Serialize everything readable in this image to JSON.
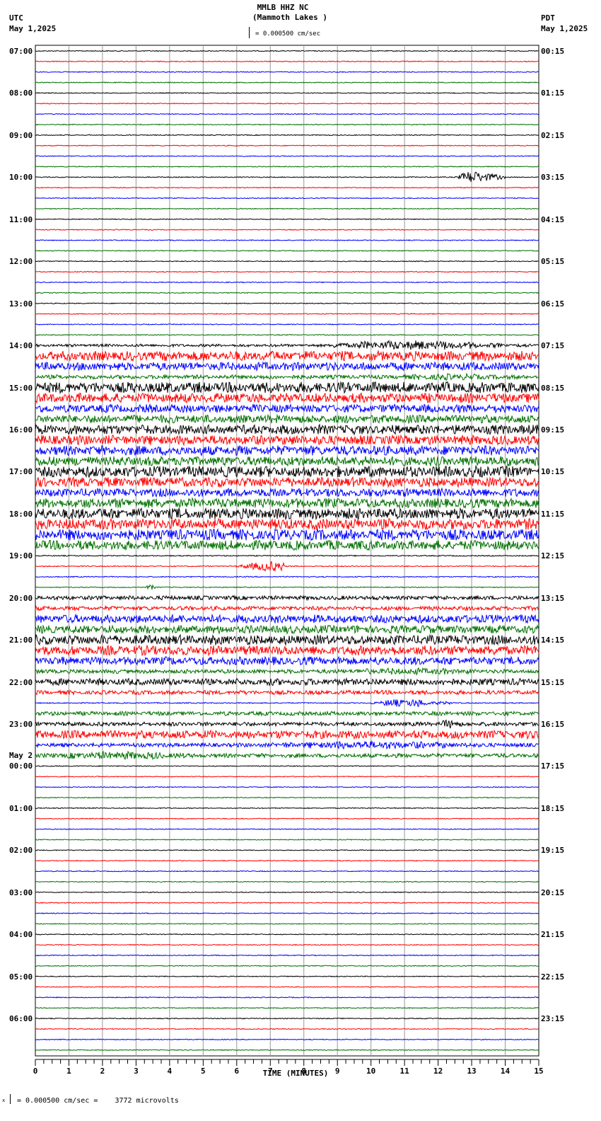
{
  "header": {
    "station": "MMLB HHZ NC",
    "location": "(Mammoth Lakes )",
    "left_tz": "UTC",
    "left_date": "May 1,2025",
    "right_tz": "PDT",
    "right_date": "May 1,2025",
    "scale": "= 0.000500 cm/sec"
  },
  "footer": {
    "scale_text": "= 0.000500 cm/sec =    3772 microvolts",
    "marker": "x"
  },
  "chart_data": {
    "type": "line",
    "title": "MMLB HHZ NC (Mammoth Lakes )",
    "xlabel": "TIME (MINUTES)",
    "xlim": [
      0,
      15
    ],
    "x_ticks": [
      "0",
      "1",
      "2",
      "3",
      "4",
      "5",
      "6",
      "7",
      "8",
      "9",
      "10",
      "11",
      "12",
      "13",
      "14",
      "15"
    ],
    "colors": [
      "#000000",
      "#ff0000",
      "#0000ff",
      "#007000"
    ],
    "left_labels": [
      "07:00",
      "08:00",
      "09:00",
      "10:00",
      "11:00",
      "12:00",
      "13:00",
      "14:00",
      "15:00",
      "16:00",
      "17:00",
      "18:00",
      "19:00",
      "20:00",
      "21:00",
      "22:00",
      "23:00",
      "00:00",
      "01:00",
      "02:00",
      "03:00",
      "04:00",
      "05:00",
      "06:00"
    ],
    "left_date_change": {
      "hour_index": 17,
      "label": "May 2"
    },
    "right_labels": [
      "00:15",
      "01:15",
      "02:15",
      "03:15",
      "04:15",
      "05:15",
      "06:15",
      "07:15",
      "08:15",
      "09:15",
      "10:15",
      "11:15",
      "12:15",
      "13:15",
      "14:15",
      "15:15",
      "16:15",
      "17:15",
      "18:15",
      "19:15",
      "20:15",
      "21:15",
      "22:15",
      "23:15"
    ],
    "trace_amplitude": [
      1,
      1,
      1,
      1,
      1,
      1,
      1,
      1,
      1,
      1,
      1,
      1,
      1,
      1,
      1,
      1,
      1,
      1,
      1,
      1,
      1,
      1,
      1,
      1,
      1,
      1,
      1,
      1,
      2,
      7,
      6,
      3,
      8,
      7,
      6,
      6,
      7,
      7,
      7,
      7,
      8,
      7,
      6,
      7,
      8,
      8,
      8,
      7,
      1.2,
      1.2,
      1.2,
      1,
      3,
      3,
      6,
      6,
      7,
      7,
      6,
      3,
      5,
      3,
      1.2,
      3,
      3,
      6,
      3,
      3,
      1,
      1,
      1,
      1,
      1,
      1,
      1,
      1,
      1,
      1,
      1,
      1,
      1,
      1,
      1,
      1,
      1,
      1,
      1,
      1,
      1,
      1,
      1,
      1,
      1,
      1,
      1,
      1
    ],
    "events": [
      {
        "trace": 12,
        "start": 12.5,
        "end": 14,
        "amp": 9
      },
      {
        "trace": 28,
        "start": 8.5,
        "end": 15,
        "amp": 7
      },
      {
        "trace": 31,
        "start": 10.5,
        "end": 15,
        "amp": 5
      },
      {
        "trace": 49,
        "start": 5.8,
        "end": 7.4,
        "amp": 7
      },
      {
        "trace": 51,
        "start": 3.3,
        "end": 3.6,
        "amp": 4
      },
      {
        "trace": 59,
        "start": 8.5,
        "end": 15,
        "amp": 5
      },
      {
        "trace": 62,
        "start": 10,
        "end": 12.5,
        "amp": 6
      },
      {
        "trace": 64,
        "start": 12,
        "end": 13,
        "amp": 7
      },
      {
        "trace": 66,
        "start": 6.5,
        "end": 15,
        "amp": 6
      },
      {
        "trace": 67,
        "start": 0,
        "end": 6,
        "amp": 6
      }
    ]
  }
}
